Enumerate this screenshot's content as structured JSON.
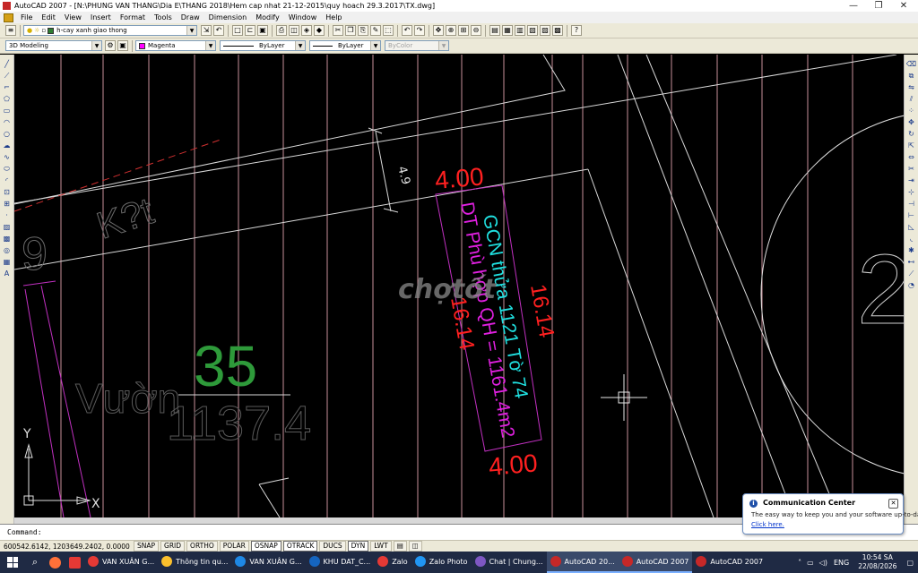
{
  "window": {
    "title": "AutoCAD 2007 - [N:\\PHUNG VAN THANG\\Dia E\\THANG 2018\\Hem cap nhat 21-12-2015\\quy hoach 29.3.2017\\TX.dwg]",
    "minimize": "—",
    "maximize": "❐",
    "close": "✕"
  },
  "menu": [
    "File",
    "Edit",
    "View",
    "Insert",
    "Format",
    "Tools",
    "Draw",
    "Dimension",
    "Modify",
    "Window",
    "Help"
  ],
  "toolbar": {
    "layer_value": "h-cay xanh giao thong",
    "workspace": "3D Modeling",
    "color": "Magenta",
    "color_hex": "#ff00ff",
    "linetype": "ByLayer",
    "lineweight": "ByLayer",
    "plotstyle": "ByColor"
  },
  "drawing": {
    "text_gcn": "GCN thửa 1121 Tờ 74",
    "text_dt": "DT Phù hợp QH = 1161.4m2",
    "dim_top": "4.00",
    "dim_bottom": "4.00",
    "dim_left": "16.14",
    "dim_right": "16.14",
    "dim_small": "4.9",
    "parcel_no": "35",
    "parcel_area": "1137.4",
    "label_vuon": "Vườn",
    "label_kt": "K?t",
    "label_9": "9",
    "ucs_y": "Y",
    "ucs_x": "X",
    "watermark": "chợtốt"
  },
  "command": {
    "prompt": "Command:"
  },
  "status": {
    "coords": "600542.6142, 1203649.2402, 0.0000",
    "toggles": [
      {
        "label": "SNAP",
        "on": false
      },
      {
        "label": "GRID",
        "on": false
      },
      {
        "label": "ORTHO",
        "on": false
      },
      {
        "label": "POLAR",
        "on": false
      },
      {
        "label": "OSNAP",
        "on": true
      },
      {
        "label": "OTRACK",
        "on": true
      },
      {
        "label": "DUCS",
        "on": false
      },
      {
        "label": "DYN",
        "on": true
      },
      {
        "label": "LWT",
        "on": false
      }
    ]
  },
  "notification": {
    "title": "Communication Center",
    "body": "The easy way to keep you and your software up-to-date.",
    "link": "Click here."
  },
  "taskbar": {
    "tasks": [
      {
        "label": "VAN XUÂN G...",
        "color": "#e53935",
        "active": false
      },
      {
        "label": "Thông tin qu...",
        "color": "#fbc02d",
        "active": false
      },
      {
        "label": "VAN XUÂN G...",
        "color": "#1e88e5",
        "active": false
      },
      {
        "label": "KHU DAT_C...",
        "color": "#1565c0",
        "active": false
      },
      {
        "label": "Zalo",
        "color": "#e53935",
        "active": false
      },
      {
        "label": "Zalo Photo",
        "color": "#2196f3",
        "active": false
      },
      {
        "label": "Chat | Chung...",
        "color": "#7e57c2",
        "active": false
      },
      {
        "label": "AutoCAD 20...",
        "color": "#c62828",
        "active": true
      },
      {
        "label": "AutoCAD 2007",
        "color": "#c62828",
        "active": true
      },
      {
        "label": "AutoCAD 2007",
        "color": "#c62828",
        "active": false
      }
    ],
    "language": "ENG",
    "time": "10:54 SA",
    "date": "22/08/2026"
  }
}
